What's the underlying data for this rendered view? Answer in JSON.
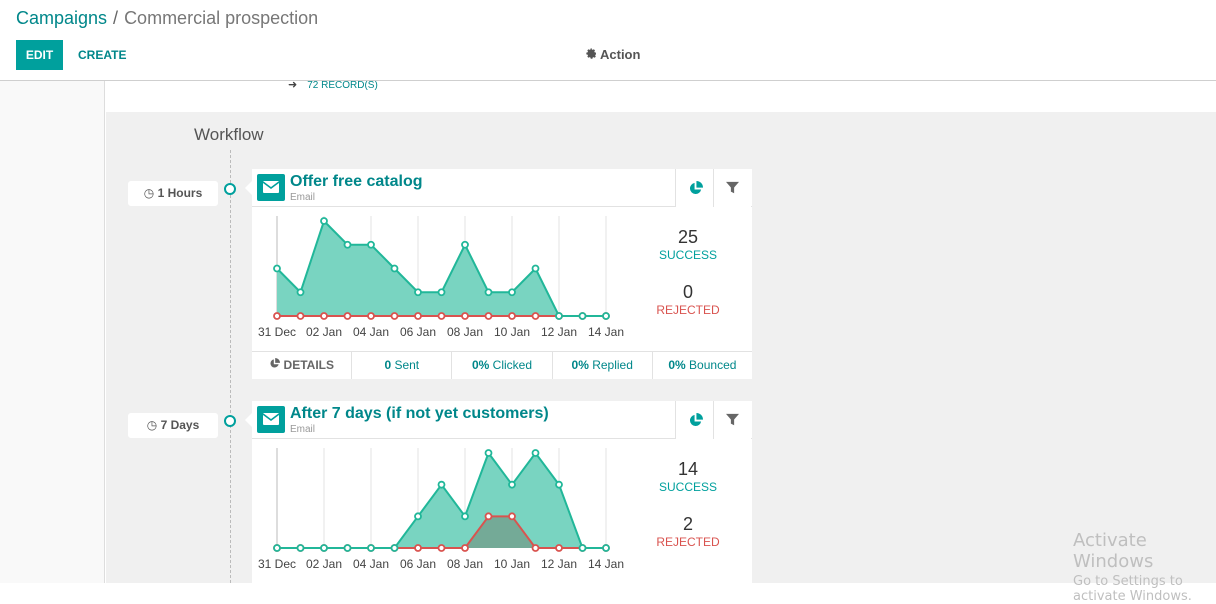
{
  "breadcrumb": {
    "parent": "Campaigns",
    "separator": "/",
    "current": "Commercial prospection"
  },
  "toolbar": {
    "edit_label": "EDIT",
    "create_label": "CREATE",
    "action_label": "Action"
  },
  "records_link": "72 RECORD(S)",
  "workflow": {
    "title": "Workflow",
    "activities": [
      {
        "delay": "1 Hours",
        "title": "Offer free catalog",
        "type": "Email",
        "stats": {
          "success": "25",
          "success_label": "SUCCESS",
          "rejected": "0",
          "rejected_label": "REJECTED"
        },
        "footer": {
          "details": "DETAILS",
          "sent_num": "0",
          "sent_label": " Sent",
          "clicked_num": "0%",
          "clicked_label": " Clicked",
          "replied_num": "0%",
          "replied_label": " Replied",
          "bounced_num": "0%",
          "bounced_label": " Bounced"
        }
      },
      {
        "delay": "7 Days",
        "title": "After 7 days (if not yet customers)",
        "type": "Email",
        "stats": {
          "success": "14",
          "success_label": "SUCCESS",
          "rejected": "2",
          "rejected_label": "REJECTED"
        }
      }
    ]
  },
  "chart_data": [
    {
      "type": "area",
      "x": [
        "31 Dec",
        "01 Jan",
        "02 Jan",
        "03 Jan",
        "04 Jan",
        "05 Jan",
        "06 Jan",
        "07 Jan",
        "08 Jan",
        "09 Jan",
        "10 Jan",
        "11 Jan",
        "12 Jan",
        "13 Jan",
        "14 Jan"
      ],
      "tick_labels": [
        "31 Dec",
        "02 Jan",
        "04 Jan",
        "06 Jan",
        "08 Jan",
        "10 Jan",
        "12 Jan",
        "14 Jan"
      ],
      "series": [
        {
          "name": "Success",
          "color": "#21b799",
          "values": [
            2,
            1,
            4,
            3,
            3,
            2,
            1,
            1,
            3,
            1,
            1,
            2,
            0,
            0,
            0
          ]
        },
        {
          "name": "Rejected",
          "color": "#d9534f",
          "values": [
            0,
            0,
            0,
            0,
            0,
            0,
            0,
            0,
            0,
            0,
            0,
            0,
            0,
            0,
            0
          ]
        }
      ],
      "ylim": [
        0,
        4
      ]
    },
    {
      "type": "area",
      "x": [
        "31 Dec",
        "01 Jan",
        "02 Jan",
        "03 Jan",
        "04 Jan",
        "05 Jan",
        "06 Jan",
        "07 Jan",
        "08 Jan",
        "09 Jan",
        "10 Jan",
        "11 Jan",
        "12 Jan",
        "13 Jan",
        "14 Jan"
      ],
      "tick_labels": [
        "31 Dec",
        "02 Jan",
        "04 Jan",
        "06 Jan",
        "08 Jan",
        "10 Jan",
        "12 Jan",
        "14 Jan"
      ],
      "series": [
        {
          "name": "Success",
          "color": "#21b799",
          "values": [
            0,
            0,
            0,
            0,
            0,
            0,
            1,
            2,
            1,
            3,
            2,
            3,
            2,
            0,
            0
          ]
        },
        {
          "name": "Rejected",
          "color": "#d9534f",
          "values": [
            0,
            0,
            0,
            0,
            0,
            0,
            0,
            0,
            0,
            1,
            1,
            0,
            0,
            0,
            0
          ]
        }
      ],
      "ylim": [
        0,
        3
      ]
    }
  ],
  "watermark": {
    "line1": "Activate Windows",
    "line2": "Go to Settings to activate Windows."
  }
}
